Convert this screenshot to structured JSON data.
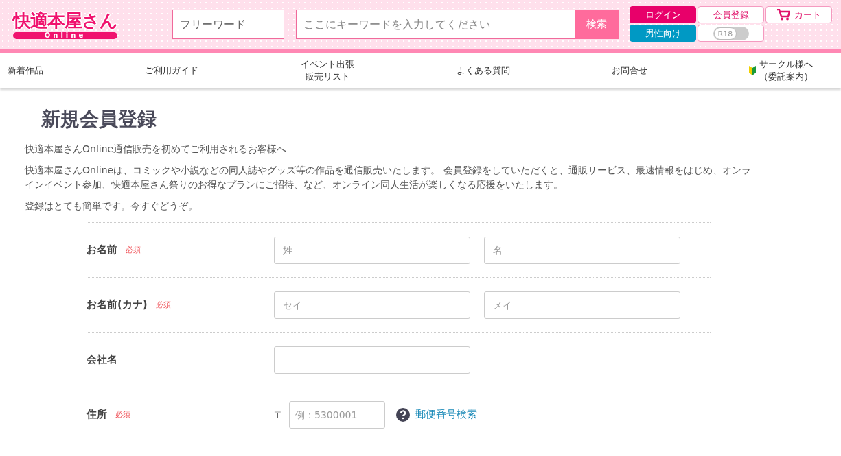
{
  "header": {
    "logo": {
      "title": "快適本屋さん",
      "subtitle": "Online"
    },
    "search": {
      "category_placeholder": "フリーワード",
      "keyword_placeholder": "ここにキーワードを入力してください",
      "button": "検索"
    },
    "account_buttons": [
      {
        "label": "ログイン",
        "kind": "primary"
      },
      {
        "label": "会員登録",
        "kind": "outline"
      },
      {
        "label": "カート",
        "kind": "cart"
      },
      {
        "label": "男性向け",
        "kind": "blue"
      },
      {
        "label": "R18",
        "kind": "toggle",
        "on": false
      }
    ]
  },
  "nav": [
    {
      "label": "新着作品"
    },
    {
      "label": "ご利用ガイド"
    },
    {
      "label": "イベント出張販売リスト"
    },
    {
      "label": "よくある質問"
    },
    {
      "label": "お問合せ"
    },
    {
      "label": "サークル様へ（委託案内）",
      "kind": "beginner"
    }
  ],
  "page": {
    "title": "新規会員登録",
    "paragraphs": [
      "快適本屋さんOnline通信販売を初めてご利用されるお客様へ",
      "快適本屋さんOnlineは、コミックや小説などの同人誌やグッズ等の作品を通信販売いたします。 会員登録をしていただくと、通販サービス、最速情報をはじめ、オンラインイベント参加、快適本屋さん祭りのお得なプランにご招待、など、オンライン同人生活が楽しくなる応援をいたします。",
      "登録はとても簡単です。今すぐどうぞ。"
    ]
  },
  "form": {
    "rows": [
      {
        "label": "お名前",
        "required": true,
        "required_label": "必須",
        "kind": "text",
        "fields": [
          {
            "placeholder": "姓"
          },
          {
            "placeholder": "名"
          }
        ]
      },
      {
        "label": "お名前(カナ)",
        "required": true,
        "required_label": "必須",
        "kind": "text",
        "fields": [
          {
            "placeholder": "セイ"
          },
          {
            "placeholder": "メイ"
          }
        ]
      },
      {
        "label": "会社名",
        "required": false,
        "kind": "empty"
      },
      {
        "label": "住所",
        "required": true,
        "required_label": "必須",
        "kind": "zip",
        "postal_mark": "〒",
        "fields": [
          {
            "placeholder": "例：5300001"
          }
        ],
        "link": "郵便番号検索"
      }
    ]
  }
}
